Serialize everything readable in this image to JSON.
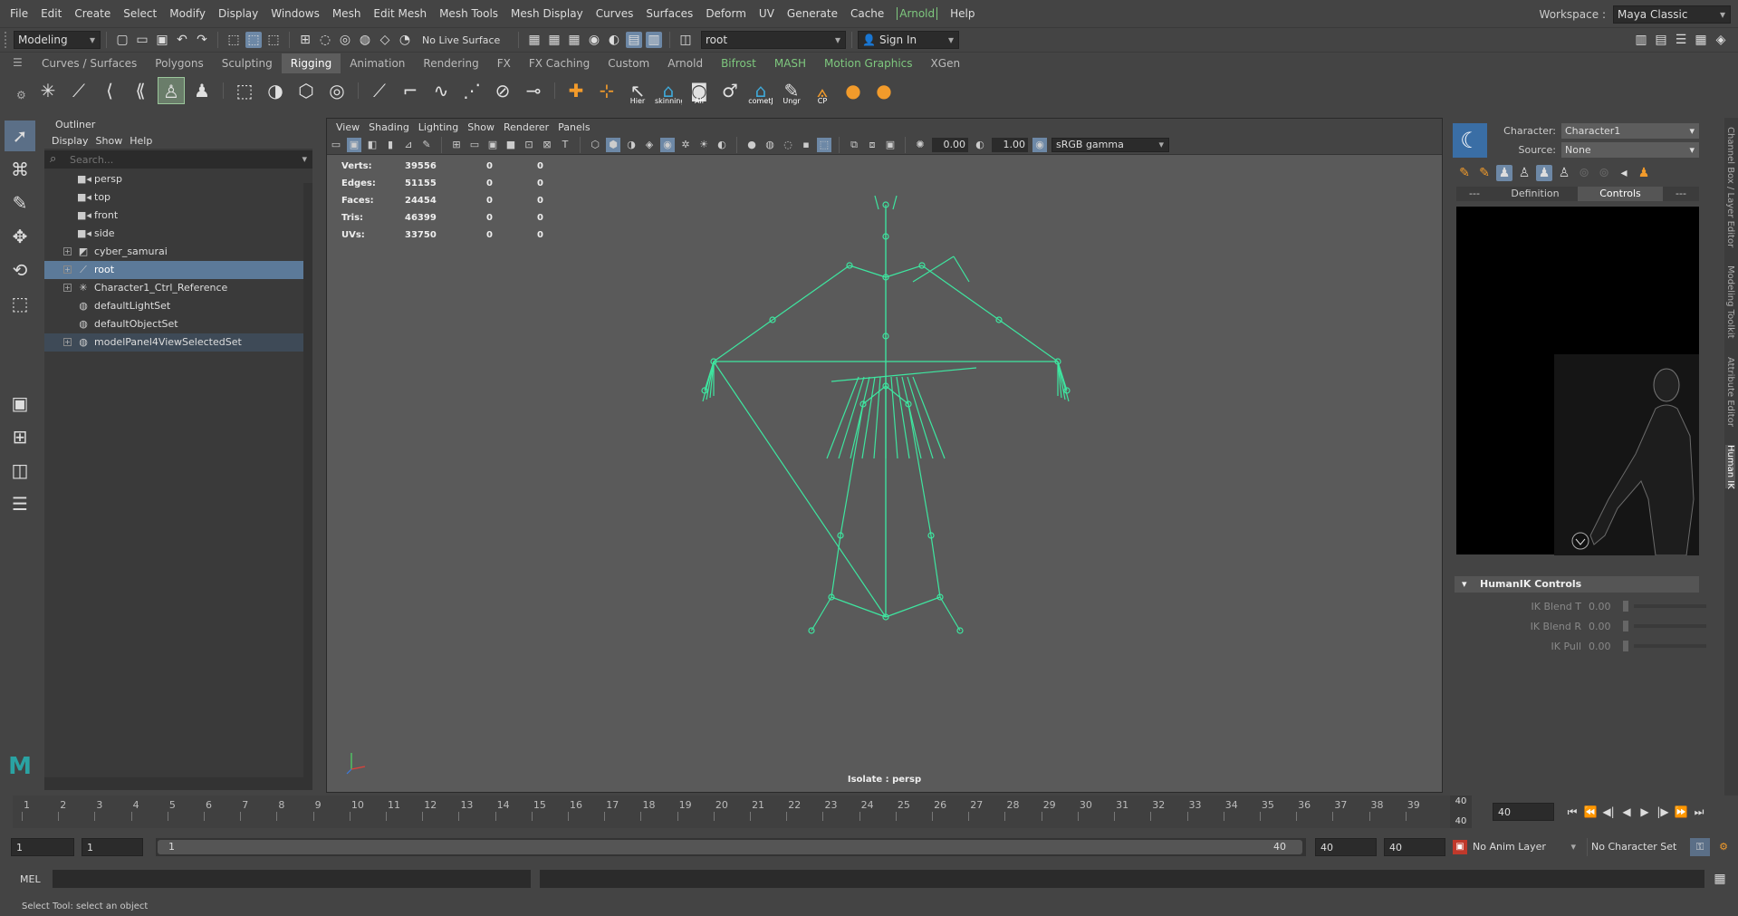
{
  "menubar": {
    "items": [
      "File",
      "Edit",
      "Create",
      "Select",
      "Modify",
      "Display",
      "Windows",
      "Mesh",
      "Edit Mesh",
      "Mesh Tools",
      "Mesh Display",
      "Curves",
      "Surfaces",
      "Deform",
      "UV",
      "Generate",
      "Cache",
      "Arnold",
      "Help"
    ],
    "workspace_label": "Workspace :",
    "workspace_value": "Maya Classic"
  },
  "statusline": {
    "mode": "Modeling",
    "live_surface": "No Live Surface",
    "name_field": "root",
    "sign_in": "Sign In"
  },
  "shelf": {
    "tabs": [
      "Curves / Surfaces",
      "Polygons",
      "Sculpting",
      "Rigging",
      "Animation",
      "Rendering",
      "FX",
      "FX Caching",
      "Custom",
      "Arnold",
      "Bifrost",
      "MASH",
      "Motion Graphics",
      "XGen"
    ],
    "active_tab": "Rigging",
    "icon_captions": [
      "Hier",
      "skinning",
      "All",
      "cometJ",
      "Ungr",
      "CP"
    ]
  },
  "outliner": {
    "title": "Outliner",
    "menus": [
      "Display",
      "Show",
      "Help"
    ],
    "search_placeholder": "Search...",
    "items": [
      {
        "label": "persp",
        "icon": "camera-icon",
        "expandable": false
      },
      {
        "label": "top",
        "icon": "camera-icon",
        "expandable": false
      },
      {
        "label": "front",
        "icon": "camera-icon",
        "expandable": false
      },
      {
        "label": "side",
        "icon": "camera-icon",
        "expandable": false
      },
      {
        "label": "cyber_samurai",
        "icon": "mesh-icon",
        "expandable": true
      },
      {
        "label": "root",
        "icon": "joint-icon",
        "expandable": true,
        "selected": true
      },
      {
        "label": "Character1_Ctrl_Reference",
        "icon": "hik-reference-icon",
        "expandable": true
      },
      {
        "label": "defaultLightSet",
        "icon": "set-icon",
        "expandable": false
      },
      {
        "label": "defaultObjectSet",
        "icon": "set-icon",
        "expandable": false
      },
      {
        "label": "modelPanel4ViewSelectedSet",
        "icon": "set-icon",
        "expandable": true,
        "highlighted": true
      }
    ]
  },
  "viewport": {
    "menus": [
      "View",
      "Shading",
      "Lighting",
      "Show",
      "Renderer",
      "Panels"
    ],
    "exposure": "0.00",
    "gamma": "1.00",
    "color_space": "sRGB gamma",
    "hud": [
      {
        "label": "Verts:",
        "a": "39556",
        "b": "0",
        "c": "0"
      },
      {
        "label": "Edges:",
        "a": "51155",
        "b": "0",
        "c": "0"
      },
      {
        "label": "Faces:",
        "a": "24454",
        "b": "0",
        "c": "0"
      },
      {
        "label": "Tris:",
        "a": "46399",
        "b": "0",
        "c": "0"
      },
      {
        "label": "UVs:",
        "a": "33750",
        "b": "0",
        "c": "0"
      }
    ],
    "isolate_label": "Isolate : persp",
    "skeleton_color": "#3ee6a0"
  },
  "humanik": {
    "character_label": "Character:",
    "character_value": "Character1",
    "source_label": "Source:",
    "source_value": "None",
    "tabs": [
      "---",
      "Definition",
      "Controls",
      "---"
    ],
    "active_tab": "Controls",
    "controls_header": "HumanIK Controls",
    "controls": [
      {
        "label": "IK Blend T",
        "value": "0.00"
      },
      {
        "label": "IK Blend R",
        "value": "0.00"
      },
      {
        "label": "IK Pull",
        "value": "0.00"
      }
    ]
  },
  "side_tabs": [
    "Channel Box / Layer Editor",
    "Modeling Toolkit",
    "Attribute Editor",
    "Human IK"
  ],
  "timeslider": {
    "ticks": [
      "1",
      "2",
      "3",
      "4",
      "5",
      "6",
      "7",
      "8",
      "9",
      "10",
      "11",
      "12",
      "13",
      "14",
      "15",
      "16",
      "17",
      "18",
      "19",
      "20",
      "21",
      "22",
      "23",
      "24",
      "25",
      "26",
      "27",
      "28",
      "29",
      "30",
      "31",
      "32",
      "33",
      "34",
      "35",
      "36",
      "37",
      "38",
      "39"
    ],
    "current_frame_top": "40",
    "current_frame_bottom": "40",
    "current_frame_field": "40"
  },
  "rangeslider": {
    "start": "1",
    "playback_start": "1",
    "handle_start": "1",
    "handle_end": "40",
    "playback_end": "40",
    "end": "40",
    "anim_layer": "No Anim Layer",
    "character_set": "No Character Set"
  },
  "commandline": {
    "label": "MEL"
  },
  "helpline": "Select Tool: select an object",
  "colors": {
    "selection": "#5c7a99",
    "accent_green": "#7ec87e",
    "maya_logo": "#2aa3a3"
  }
}
